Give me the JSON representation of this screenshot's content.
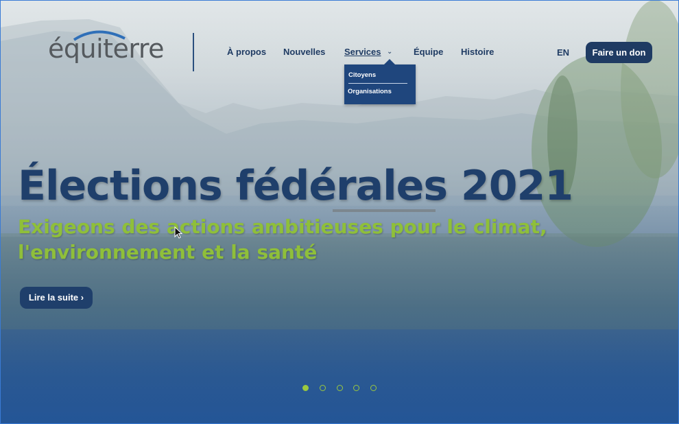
{
  "logo": {
    "text": "équiterre"
  },
  "nav": {
    "items": [
      "À propos",
      "Nouvelles",
      "Services",
      "Équipe",
      "Histoire"
    ],
    "dropdown": [
      "Citoyens",
      "Organisations"
    ]
  },
  "lang": "EN",
  "donate_label": "Faire un don",
  "hero": {
    "title": "Élections fédérales 2021",
    "subtitle": "Exigeons des actions ambitieuses pour le climat, l'environnement et la santé",
    "cta_label": "Lire la suite ›"
  },
  "carousel": {
    "slides": 5,
    "active": 1
  },
  "colors": {
    "navy": "#1f3f6b",
    "green": "#8fbf3a",
    "dropdown": "#1f467d"
  }
}
